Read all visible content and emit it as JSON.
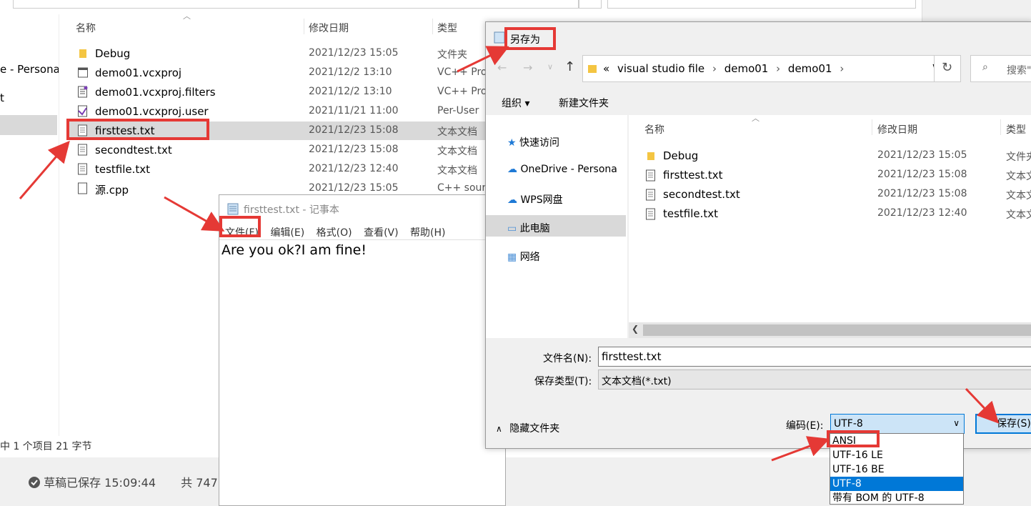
{
  "explorer": {
    "nav": [
      "e - Persona",
      "t"
    ],
    "columns": {
      "name": "名称",
      "date": "修改日期",
      "type": "类型"
    },
    "files": [
      {
        "name": "Debug",
        "date": "2021/12/23 15:05",
        "type": "文件夹",
        "icon": "folder-icon"
      },
      {
        "name": "demo01.vcxproj",
        "date": "2021/12/2 13:10",
        "type": "VC++ Pro",
        "icon": "vcxproj-icon"
      },
      {
        "name": "demo01.vcxproj.filters",
        "date": "2021/12/2 13:10",
        "type": "VC++ Pro",
        "icon": "filters-icon"
      },
      {
        "name": "demo01.vcxproj.user",
        "date": "2021/11/21 11:00",
        "type": "Per-User",
        "icon": "user-file-icon"
      },
      {
        "name": "firsttest.txt",
        "date": "2021/12/23 15:08",
        "type": "文本文档",
        "icon": "text-file-icon"
      },
      {
        "name": "secondtest.txt",
        "date": "2021/12/23 15:08",
        "type": "文本文档",
        "icon": "text-file-icon"
      },
      {
        "name": "testfile.txt",
        "date": "2021/12/23 12:40",
        "type": "文本文档",
        "icon": "text-file-icon"
      },
      {
        "name": "源.cpp",
        "date": "2021/12/23 15:05",
        "type": "C++ sour",
        "icon": "cpp-file-icon"
      }
    ],
    "status": "中 1 个项目  21 字节"
  },
  "page_footer": {
    "draft": "草稿已保存 15:09:44",
    "count": "共 747"
  },
  "notepad": {
    "title": "firsttest.txt - 记事本",
    "menu": [
      "文件(F)",
      "编辑(E)",
      "格式(O)",
      "查看(V)",
      "帮助(H)"
    ],
    "content": "Are you ok?I am fine!"
  },
  "dialog": {
    "title": "另存为",
    "breadcrumb": [
      "«",
      "visual studio file",
      "demo01",
      "demo01"
    ],
    "search_placeholder": "搜索\"",
    "organize": "组织 ▾",
    "new_folder": "新建文件夹",
    "nav": [
      "快速访问",
      "OneDrive - Persona",
      "WPS网盘",
      "此电脑",
      "网络"
    ],
    "columns": {
      "name": "名称",
      "date": "修改日期",
      "type": "类型"
    },
    "files": [
      {
        "name": "Debug",
        "date": "2021/12/23 15:05",
        "type": "文件夹"
      },
      {
        "name": "firsttest.txt",
        "date": "2021/12/23 15:08",
        "type": "文本文"
      },
      {
        "name": "secondtest.txt",
        "date": "2021/12/23 15:08",
        "type": "文本文"
      },
      {
        "name": "testfile.txt",
        "date": "2021/12/23 12:40",
        "type": "文本文"
      }
    ],
    "filename_label": "文件名(N):",
    "filename_value": "firsttest.txt",
    "filetype_label": "保存类型(T):",
    "filetype_value": "文本文档(*.txt)",
    "hide_folders": "隐藏文件夹",
    "encoding_label": "编码(E):",
    "encoding_value": "UTF-8",
    "encoding_options": [
      "ANSI",
      "UTF-16 LE",
      "UTF-16 BE",
      "UTF-8",
      "带有 BOM 的 UTF-8"
    ],
    "save_button": "保存(S)"
  },
  "colors": {
    "highlight": "#0078d7",
    "annotation": "#e53935"
  }
}
